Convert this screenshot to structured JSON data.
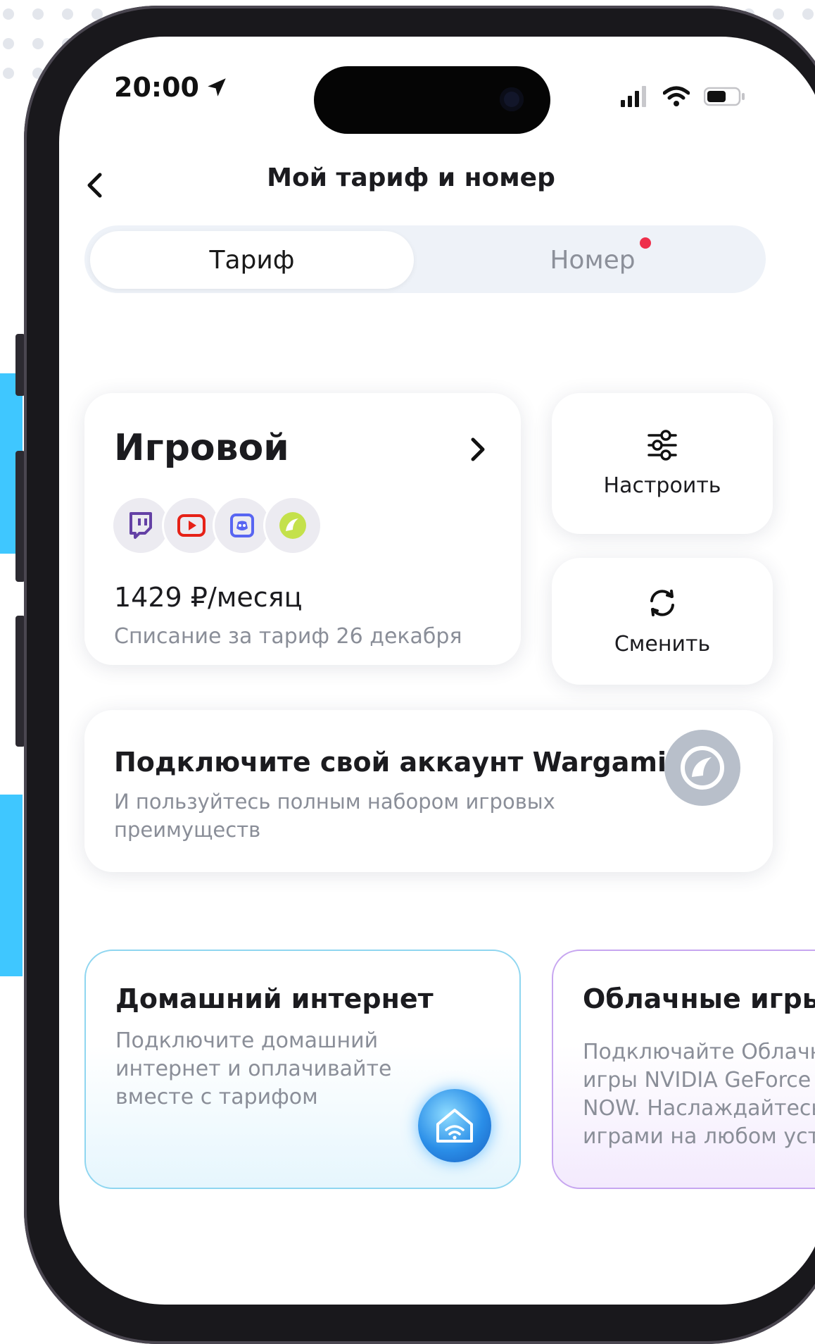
{
  "status_bar": {
    "time": "20:00"
  },
  "header": {
    "title": "Мой тариф и номер"
  },
  "tabs": [
    {
      "label": "Тариф",
      "active": true
    },
    {
      "label": "Номер",
      "active": false,
      "has_badge": true
    }
  ],
  "tariff": {
    "name": "Игровой",
    "price": "1429 ₽/месяц",
    "charge_note": "Списание за тариф 26 декабря",
    "app_icons": [
      "twitch-icon",
      "youtube-icon",
      "discord-icon",
      "wargaming-icon"
    ]
  },
  "actions": [
    {
      "label": "Настроить",
      "icon": "sliders-icon"
    },
    {
      "label": "Сменить",
      "icon": "refresh-icon"
    }
  ],
  "wargaming": {
    "title": "Подключите свой аккаунт Wargaming",
    "subtitle_line1": "И пользуйтесь полным набором игровых",
    "subtitle_line2": "преимуществ"
  },
  "promos": [
    {
      "title": "Домашний интернет",
      "lines": [
        "Подключите домашний",
        "интернет и оплачивайте",
        "вместе с тарифом"
      ]
    },
    {
      "title": "Облачные игры С",
      "lines": [
        "Подключайте Облачн",
        "игры NVIDIA GeForce",
        "NOW. Наслаждайтесь",
        "играми на любом устр"
      ]
    }
  ],
  "colors": {
    "accent_red": "#ee2f4b",
    "home_border": "#8fd6f0",
    "cloud_border": "#c7a6f0",
    "side_strip": "#3fc7ff"
  }
}
